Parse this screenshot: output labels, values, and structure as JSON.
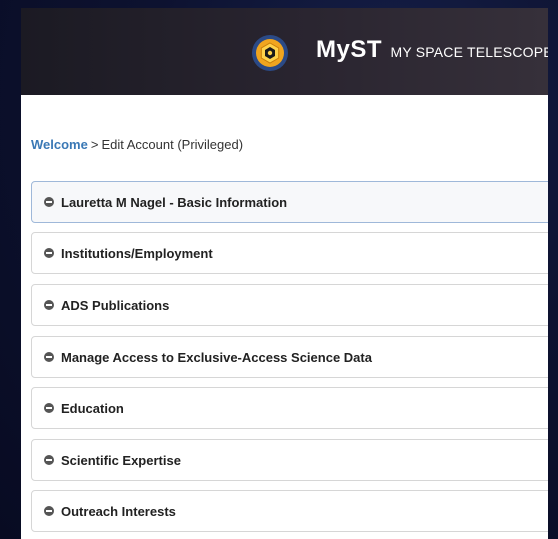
{
  "header": {
    "brand_name": "MyST",
    "tagline": "MY SPACE TELESCOPE"
  },
  "breadcrumb": {
    "home": "Welcome",
    "separator": ">",
    "current": "Edit Account (Privileged)"
  },
  "sections": [
    {
      "label": "Lauretta M Nagel - Basic Information",
      "icon": "minus-circle-icon",
      "active": true
    },
    {
      "label": "Institutions/Employment",
      "icon": "minus-circle-icon"
    },
    {
      "label": "ADS Publications",
      "icon": "minus-circle-icon"
    },
    {
      "label": "Manage Access to Exclusive-Access Science Data",
      "icon": "minus-circle-icon"
    },
    {
      "label": "Education",
      "icon": "minus-circle-icon"
    },
    {
      "label": "Scientific Expertise",
      "icon": "minus-circle-icon"
    },
    {
      "label": "Outreach Interests",
      "icon": "minus-circle-icon"
    }
  ],
  "colors": {
    "link": "#3a78b5",
    "logo_ring": "#f0a51f",
    "logo_bg": "#2b4a86"
  }
}
